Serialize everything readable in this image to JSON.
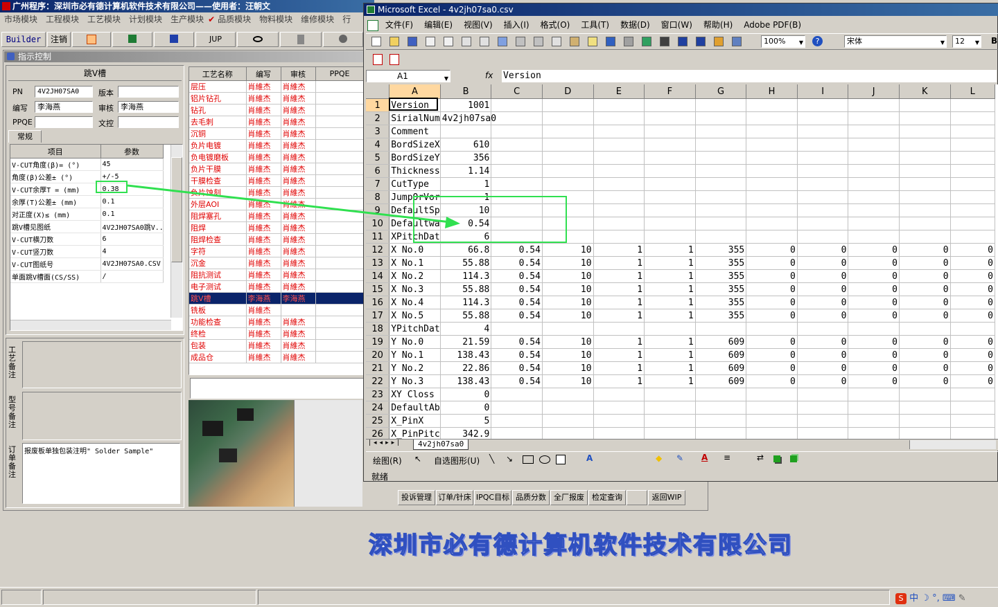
{
  "app": {
    "title": "广州程序：深圳市必有德计算机软件技术有限公司——使用者：汪朝文",
    "menu": [
      "市场模块",
      "工程模块",
      "工艺模块",
      "计划模块",
      "生产模块",
      "品质模块",
      "物料模块",
      "维修模块",
      "行"
    ],
    "toolbar": {
      "builder": "Builder",
      "logout": "注销",
      "jup": "JUP"
    },
    "panel_title": "指示控制",
    "section_title": "跳V槽",
    "pn_label": "PN",
    "pn_value": "4V2JH07SA0",
    "version_label": "版本",
    "editor_label": "编写",
    "editor_value": "李海燕",
    "reviewer_label": "审核",
    "reviewer_value": "李海燕",
    "ppqe_label": "PPQE",
    "control_label": "文控",
    "tab_general": "常规",
    "param_headers": [
      "项目",
      "参数"
    ],
    "params": [
      {
        "item": "V-CUT角度(β)= (°)",
        "value": "45"
      },
      {
        "item": "角度(β)公差± (°)",
        "value": "+/-5"
      },
      {
        "item": "V-CUT余厚T = (mm)",
        "value": "0.38"
      },
      {
        "item": "余厚(T)公差± (mm)",
        "value": "0.1"
      },
      {
        "item": "对正度(X)≤ (mm)",
        "value": "0.1"
      },
      {
        "item": "跳V槽见图纸",
        "value": "4V2JH07SA0跳V..."
      },
      {
        "item": "V-CUT横刀数",
        "value": "6"
      },
      {
        "item": "V-CUT竖刀数",
        "value": "4"
      },
      {
        "item": "V-CUT图纸号",
        "value": "4V2JH07SA0.CSV"
      },
      {
        "item": "单面跳V槽面(CS/SS)",
        "value": "/"
      }
    ],
    "notes": {
      "process_label": "工艺备注",
      "model_label": "型号备注",
      "order_label": "订单备注",
      "order_text": "报废板单独包装注明\" Solder Sample\""
    },
    "proc_headers": [
      "工艺名称",
      "编写",
      "审核",
      "PPQE"
    ],
    "procs": [
      {
        "name": "层压",
        "w": "肖維杰",
        "r": "肖維杰"
      },
      {
        "name": "铝片钻孔",
        "w": "肖維杰",
        "r": "肖維杰"
      },
      {
        "name": "钻孔",
        "w": "肖維杰",
        "r": "肖維杰"
      },
      {
        "name": "去毛刺",
        "w": "肖維杰",
        "r": "肖維杰"
      },
      {
        "name": "沉铜",
        "w": "肖維杰",
        "r": "肖維杰"
      },
      {
        "name": "负片电镀",
        "w": "肖維杰",
        "r": "肖維杰"
      },
      {
        "name": "负电镀磨板",
        "w": "肖維杰",
        "r": "肖維杰"
      },
      {
        "name": "负片干膜",
        "w": "肖維杰",
        "r": "肖維杰"
      },
      {
        "name": "干膜检查",
        "w": "肖維杰",
        "r": "肖維杰"
      },
      {
        "name": "负片蚀刻",
        "w": "肖維杰",
        "r": "肖維杰"
      },
      {
        "name": "外层AOI",
        "w": "肖維杰",
        "r": "肖維杰"
      },
      {
        "name": "阻焊塞孔",
        "w": "肖維杰",
        "r": "肖維杰"
      },
      {
        "name": "阻焊",
        "w": "肖維杰",
        "r": "肖維杰"
      },
      {
        "name": "阻焊检查",
        "w": "肖維杰",
        "r": "肖維杰"
      },
      {
        "name": "字符",
        "w": "肖維杰",
        "r": "肖維杰"
      },
      {
        "name": "沉金",
        "w": "肖維杰",
        "r": "肖維杰"
      },
      {
        "name": "阻抗测试",
        "w": "肖維杰",
        "r": "肖維杰"
      },
      {
        "name": "电子测试",
        "w": "肖維杰",
        "r": "肖維杰"
      },
      {
        "name": "跳V槽",
        "w": "李海燕",
        "r": "李海燕"
      },
      {
        "name": "铣板",
        "w": "肖維杰",
        "r": ""
      },
      {
        "name": "功能检查",
        "w": "肖維杰",
        "r": "肖維杰"
      },
      {
        "name": "终检",
        "w": "肖維杰",
        "r": "肖維杰"
      },
      {
        "name": "包装",
        "w": "肖維杰",
        "r": "肖維杰"
      },
      {
        "name": "成品仓",
        "w": "肖維杰",
        "r": "肖維杰"
      }
    ],
    "bottom_buttons": [
      "投诉管理",
      "订单/针床",
      "IPQC目标",
      "品质分数",
      "全厂报废",
      "检定查询",
      "",
      "返回WIP"
    ],
    "banner": "深圳市必有德计算机软件技术有限公司"
  },
  "excel": {
    "title": "Microsoft Excel - 4v2jh07sa0.csv",
    "menu": [
      "文件(F)",
      "编辑(E)",
      "视图(V)",
      "插入(I)",
      "格式(O)",
      "工具(T)",
      "数据(D)",
      "窗口(W)",
      "帮助(H)",
      "Adobe PDF(B)"
    ],
    "zoom": "100%",
    "font": "宋体",
    "font_size": "12",
    "name_box": "A1",
    "fx": "fx",
    "formula": "Version",
    "columns": [
      "A",
      "B",
      "C",
      "D",
      "E",
      "F",
      "G",
      "H",
      "I",
      "J",
      "K",
      "L"
    ],
    "rows": [
      [
        "Version",
        "1001",
        "",
        "",
        "",
        "",
        "",
        "",
        "",
        "",
        "",
        ""
      ],
      [
        "SirialNum",
        "4v2jh07sa0",
        "",
        "",
        "",
        "",
        "",
        "",
        "",
        "",
        "",
        ""
      ],
      [
        "Comment",
        "",
        "",
        "",
        "",
        "",
        "",
        "",
        "",
        "",
        "",
        ""
      ],
      [
        "BordSizeX",
        "610",
        "",
        "",
        "",
        "",
        "",
        "",
        "",
        "",
        "",
        ""
      ],
      [
        "BordSizeY",
        "356",
        "",
        "",
        "",
        "",
        "",
        "",
        "",
        "",
        "",
        ""
      ],
      [
        "Thickness",
        "1.14",
        "",
        "",
        "",
        "",
        "",
        "",
        "",
        "",
        "",
        ""
      ],
      [
        "CutType",
        "1",
        "",
        "",
        "",
        "",
        "",
        "",
        "",
        "",
        "",
        ""
      ],
      [
        "JumpOrVor",
        "1",
        "",
        "",
        "",
        "",
        "",
        "",
        "",
        "",
        "",
        ""
      ],
      [
        "DefaultSp",
        "10",
        "",
        "",
        "",
        "",
        "",
        "",
        "",
        "",
        "",
        ""
      ],
      [
        "Defaultwa",
        "0.54",
        "",
        "",
        "",
        "",
        "",
        "",
        "",
        "",
        "",
        ""
      ],
      [
        "XPitchDat",
        "6",
        "",
        "",
        "",
        "",
        "",
        "",
        "",
        "",
        "",
        ""
      ],
      [
        "X No.0",
        "66.8",
        "0.54",
        "10",
        "1",
        "1",
        "355",
        "0",
        "0",
        "0",
        "0",
        "0"
      ],
      [
        "X No.1",
        "55.88",
        "0.54",
        "10",
        "1",
        "1",
        "355",
        "0",
        "0",
        "0",
        "0",
        "0"
      ],
      [
        "X No.2",
        "114.3",
        "0.54",
        "10",
        "1",
        "1",
        "355",
        "0",
        "0",
        "0",
        "0",
        "0"
      ],
      [
        "X No.3",
        "55.88",
        "0.54",
        "10",
        "1",
        "1",
        "355",
        "0",
        "0",
        "0",
        "0",
        "0"
      ],
      [
        "X No.4",
        "114.3",
        "0.54",
        "10",
        "1",
        "1",
        "355",
        "0",
        "0",
        "0",
        "0",
        "0"
      ],
      [
        "X No.5",
        "55.88",
        "0.54",
        "10",
        "1",
        "1",
        "355",
        "0",
        "0",
        "0",
        "0",
        "0"
      ],
      [
        "YPitchDat",
        "4",
        "",
        "",
        "",
        "",
        "",
        "",
        "",
        "",
        "",
        ""
      ],
      [
        "Y No.0",
        "21.59",
        "0.54",
        "10",
        "1",
        "1",
        "609",
        "0",
        "0",
        "0",
        "0",
        "0"
      ],
      [
        "Y No.1",
        "138.43",
        "0.54",
        "10",
        "1",
        "1",
        "609",
        "0",
        "0",
        "0",
        "0",
        "0"
      ],
      [
        "Y No.2",
        "22.86",
        "0.54",
        "10",
        "1",
        "1",
        "609",
        "0",
        "0",
        "0",
        "0",
        "0"
      ],
      [
        "Y No.3",
        "138.43",
        "0.54",
        "10",
        "1",
        "1",
        "609",
        "0",
        "0",
        "0",
        "0",
        "0"
      ],
      [
        "XY Closs",
        "0",
        "",
        "",
        "",
        "",
        "",
        "",
        "",
        "",
        "",
        ""
      ],
      [
        "DefaultAb",
        "0",
        "",
        "",
        "",
        "",
        "",
        "",
        "",
        "",
        "",
        ""
      ],
      [
        "X_PinX",
        "5",
        "",
        "",
        "",
        "",
        "",
        "",
        "",
        "",
        "",
        ""
      ],
      [
        "X_PinPitc",
        "342.9",
        "",
        "",
        "",
        "",
        "",
        "",
        "",
        "",
        "",
        ""
      ]
    ],
    "sheet_tab": "4v2jh07sa0",
    "draw_label": "绘图(R)",
    "autoshape_label": "自选图形(U)",
    "status": "就绪"
  },
  "tray": {
    "ime": "中"
  }
}
